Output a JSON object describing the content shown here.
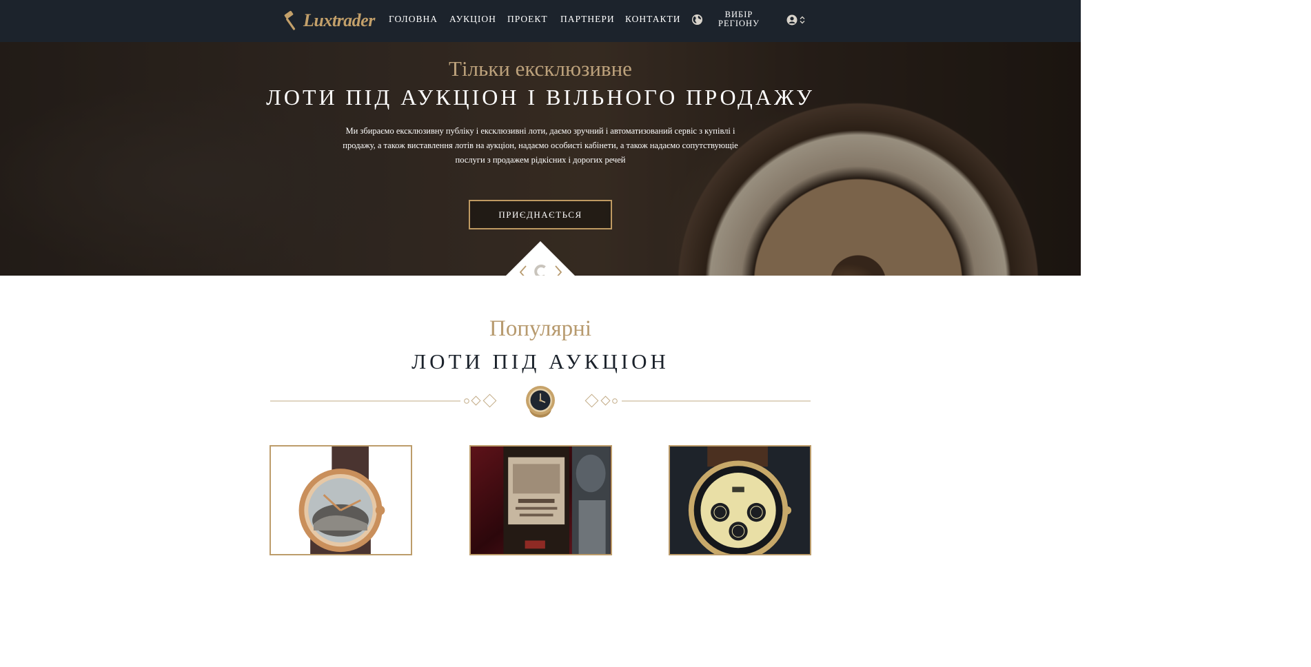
{
  "nav": {
    "logo_text": "Luxtrader",
    "items": [
      {
        "label": "ГОЛОВНА"
      },
      {
        "label": "АУКЦІОН"
      },
      {
        "label": "ПРОЕКТ"
      },
      {
        "label": "ПАРТНЕРИ"
      },
      {
        "label": "КОНТАКТИ"
      }
    ],
    "region_label": "ВИБІР РЕГІОНУ"
  },
  "hero": {
    "kicker": "Тільки ексклюзивне",
    "title": "ЛОТИ ПІД АУКЦІОН І ВІЛЬНОГО ПРОДАЖУ",
    "text": "Ми збираємо ексклюзивну публіку і ексклюзивні лоти, даємо зручний і автоматизований сервіс з купівлі і продажу, а також виставлення лотів на аукціон, надаємо особисті кабінети, а також надаємо сопутствующіе послуги з продажем рідкісних і дорогих речей",
    "button_label": "ПРИЄДНАЄТЬСЯ"
  },
  "popular": {
    "kicker": "Популярні",
    "title": "ЛОТИ ПІД АУКЦІОН"
  },
  "icons": {
    "gavel": "gavel-icon",
    "globe": "globe-icon",
    "user": "user-icon",
    "chevron": "chevron-updown-icon",
    "prev": "chevron-left-icon",
    "next": "chevron-right-icon",
    "watch": "watch-icon"
  },
  "colors": {
    "nav_bg": "#1c232c",
    "gold": "#bf9a62",
    "gold_text": "#b79a6e",
    "dark_text": "#1b222b"
  }
}
